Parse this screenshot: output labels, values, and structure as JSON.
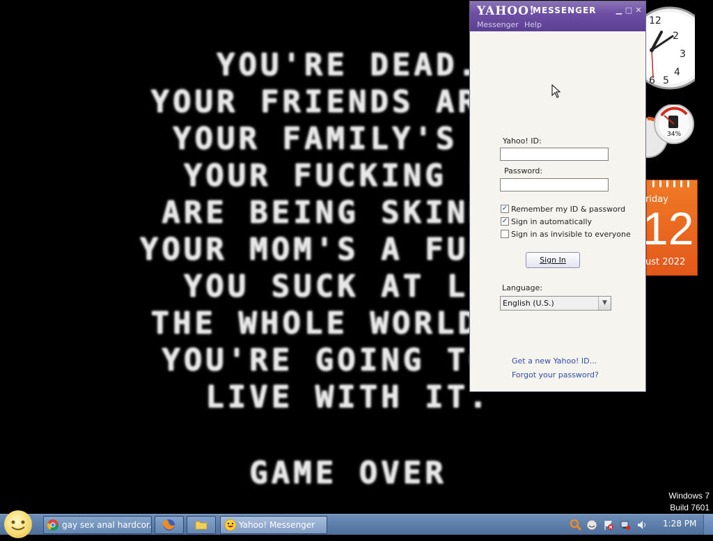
{
  "wallpaper": {
    "lines": [
      "YOU'RE DEAD.",
      "YOUR FRIENDS ARE I",
      "YOUR FAMILY'S DI",
      "YOUR FUCKING PI",
      "ARE BEING SKINNED",
      "YOUR MOM'S A FUCKIN",
      "YOU SUCK AT LII",
      "THE WHOLE WORLD HA",
      "YOU'RE GOING TO I",
      "LIVE WITH IT.",
      "",
      "GAME OVER"
    ]
  },
  "gadgets": {
    "clock": {
      "icon": "analog-clock-icon"
    },
    "cpu_meter": {
      "percent_label": "34%"
    },
    "calendar": {
      "day": "riday",
      "date": "12",
      "month_year": "ust 2022"
    }
  },
  "yahoo": {
    "brand": "YAHOO!",
    "brand_suffix": "MESSENGER",
    "menu": [
      "Messenger",
      "Help"
    ],
    "id_label": "Yahoo! ID:",
    "id_value": "",
    "password_label": "Password:",
    "password_value": "",
    "remember_label": "Remember my ID & password",
    "remember_checked": true,
    "auto_label": "Sign in automatically",
    "auto_checked": true,
    "invisible_label": "Sign in as invisible to everyone",
    "invisible_checked": false,
    "sign_in": "Sign In",
    "language_label": "Language:",
    "language_value": "English (U.S.)",
    "new_id_link": "Get a new Yahoo! ID...",
    "forgot_link": "Forgot your password?"
  },
  "watermark": {
    "line1": "Windows 7",
    "line2": "Build 7601"
  },
  "taskbar": {
    "items": [
      {
        "label": "gay sex anal hardcor...",
        "icon": "chrome-icon"
      },
      {
        "label": "",
        "icon": "firefox-icon"
      },
      {
        "label": "",
        "icon": "folder-icon"
      },
      {
        "label": "Yahoo! Messenger",
        "icon": "yahoo-smiley-icon"
      }
    ],
    "time": "1:28 PM"
  },
  "colors": {
    "yahoo_purple": "#6e4fa5",
    "calendar_orange": "#e8631f",
    "taskbar_blue": "#5b7fad"
  }
}
